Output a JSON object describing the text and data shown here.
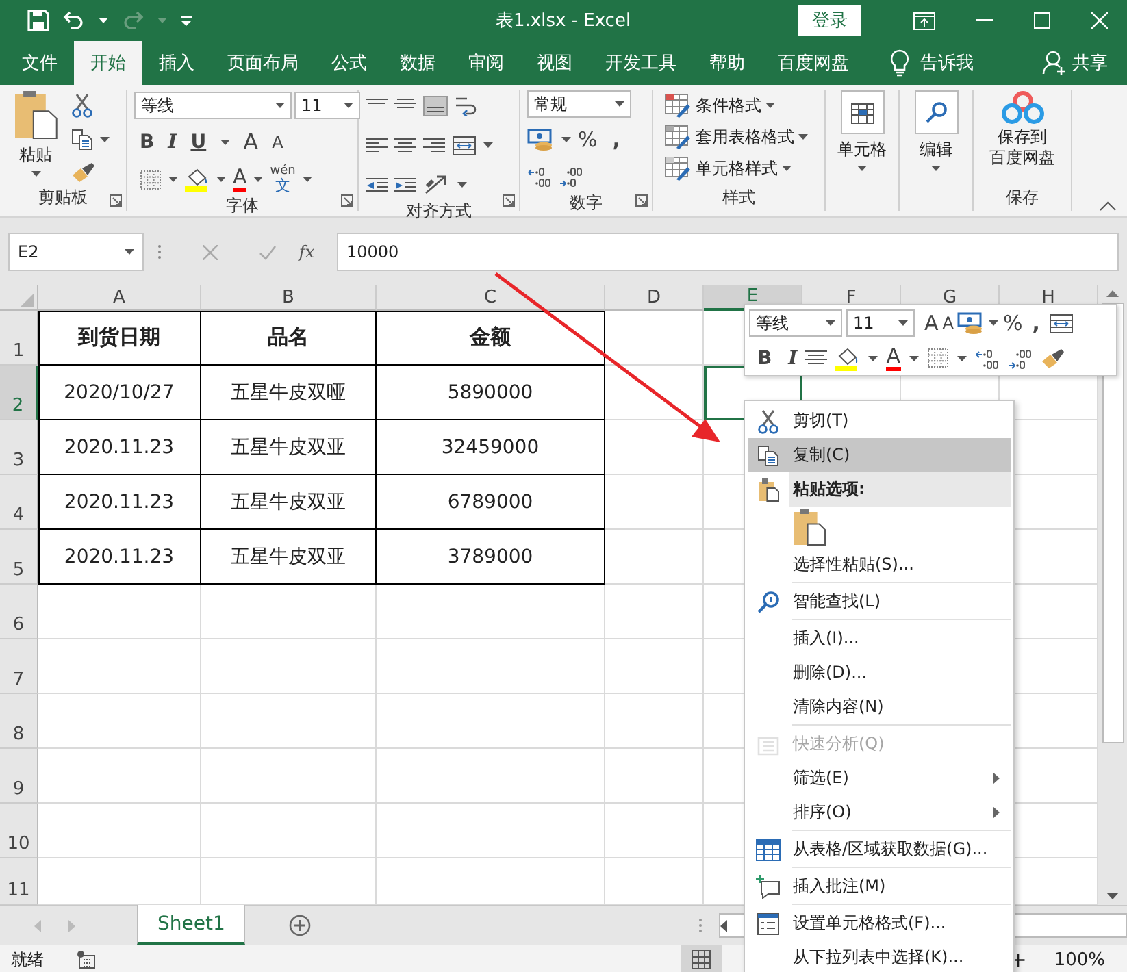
{
  "title_bar": {
    "title": "表1.xlsx  -  Excel",
    "login": "登录"
  },
  "menu_tabs": [
    {
      "label": "文件",
      "selected": false
    },
    {
      "label": "开始",
      "selected": true
    },
    {
      "label": "插入",
      "selected": false
    },
    {
      "label": "页面布局",
      "selected": false
    },
    {
      "label": "公式",
      "selected": false
    },
    {
      "label": "数据",
      "selected": false
    },
    {
      "label": "审阅",
      "selected": false
    },
    {
      "label": "视图",
      "selected": false
    },
    {
      "label": "开发工具",
      "selected": false
    },
    {
      "label": "帮助",
      "selected": false
    },
    {
      "label": "百度网盘",
      "selected": false
    }
  ],
  "tell_me": "告诉我",
  "share": "共享",
  "ribbon": {
    "clipboard": {
      "paste": "粘贴",
      "label": "剪贴板"
    },
    "font": {
      "name": "等线",
      "size": "11",
      "bold": "B",
      "italic": "I",
      "underline": "U",
      "grow": "A",
      "shrink": "A",
      "font_color": "A",
      "phonetic_top": "wén",
      "phonetic_bottom": "文",
      "label": "字体"
    },
    "alignment": {
      "label": "对齐方式"
    },
    "number": {
      "format": "常规",
      "percent": "%",
      "comma": ",",
      "label": "数字"
    },
    "styles": {
      "items": [
        "条件格式",
        "套用表格格式",
        "单元格样式"
      ],
      "label": "样式"
    },
    "cells": {
      "button": "单元格"
    },
    "editing": {
      "button": "编辑"
    },
    "save": {
      "button_line1": "保存到",
      "button_line2": "百度网盘",
      "label": "保存"
    }
  },
  "formula_bar": {
    "name_box": "E2",
    "fx": "fx",
    "value": "10000"
  },
  "sheet": {
    "columns": [
      {
        "label": "A",
        "selected": false
      },
      {
        "label": "B",
        "selected": false
      },
      {
        "label": "C",
        "selected": false
      },
      {
        "label": "D",
        "selected": false
      },
      {
        "label": "E",
        "selected": true
      },
      {
        "label": "F",
        "selected": false
      },
      {
        "label": "G",
        "selected": false
      },
      {
        "label": "H",
        "selected": false
      }
    ],
    "rows": [
      {
        "label": "1",
        "selected": false,
        "kind": "header",
        "cells": [
          "到货日期",
          "品名",
          "金额"
        ]
      },
      {
        "label": "2",
        "selected": true,
        "kind": "data",
        "cells": [
          "2020/10/27",
          "五星牛皮双哑",
          "5890000"
        ]
      },
      {
        "label": "3",
        "selected": false,
        "kind": "data",
        "cells": [
          "2020.11.23",
          "五星牛皮双亚",
          "32459000"
        ]
      },
      {
        "label": "4",
        "selected": false,
        "kind": "data",
        "cells": [
          "2020.11.23",
          "五星牛皮双亚",
          "6789000"
        ]
      },
      {
        "label": "5",
        "selected": false,
        "kind": "data",
        "cells": [
          "2020.11.23",
          "五星牛皮双亚",
          "3789000"
        ]
      },
      {
        "label": "6",
        "selected": false,
        "kind": "empty"
      },
      {
        "label": "7",
        "selected": false,
        "kind": "empty"
      },
      {
        "label": "8",
        "selected": false,
        "kind": "empty"
      },
      {
        "label": "9",
        "selected": false,
        "kind": "empty"
      },
      {
        "label": "10",
        "selected": false,
        "kind": "empty"
      },
      {
        "label": "11",
        "selected": false,
        "kind": "empty"
      }
    ]
  },
  "sheet_tabs": [
    {
      "label": "Sheet1",
      "selected": true
    }
  ],
  "status_bar": {
    "status": "就绪",
    "zoom_in": "+",
    "zoom": "100%"
  },
  "mini_toolbar": {
    "font": "等线",
    "size": "11",
    "grow": "A",
    "shrink": "A",
    "percent": "%",
    "comma": ",",
    "bold": "B",
    "italic": "I",
    "font_color": "A"
  },
  "context_menu": [
    {
      "kind": "cut",
      "label": "剪切(T)",
      "selected": false,
      "disabled": false,
      "submenu": false,
      "separator_before": false
    },
    {
      "kind": "copy",
      "label": "复制(C)",
      "selected": true,
      "disabled": false,
      "submenu": false,
      "separator_before": false
    },
    {
      "kind": "paste_header",
      "label": "粘贴选项:",
      "selected": false,
      "disabled": false,
      "submenu": false,
      "separator_before": false
    },
    {
      "kind": "paste_options",
      "selected": false,
      "disabled": false,
      "submenu": false,
      "separator_before": false
    },
    {
      "kind": "plain",
      "label": "选择性粘贴(S)...",
      "selected": false,
      "disabled": false,
      "submenu": false,
      "separator_before": false
    },
    {
      "kind": "lookup",
      "label": "智能查找(L)",
      "selected": false,
      "disabled": false,
      "submenu": false,
      "separator_before": true
    },
    {
      "kind": "plain",
      "label": "插入(I)...",
      "selected": false,
      "disabled": false,
      "submenu": false,
      "separator_before": true
    },
    {
      "kind": "plain",
      "label": "删除(D)...",
      "selected": false,
      "disabled": false,
      "submenu": false,
      "separator_before": false
    },
    {
      "kind": "plain",
      "label": "清除内容(N)",
      "selected": false,
      "disabled": false,
      "submenu": false,
      "separator_before": false
    },
    {
      "kind": "quick_analysis",
      "label": "快速分析(Q)",
      "selected": false,
      "disabled": true,
      "submenu": false,
      "separator_before": true
    },
    {
      "kind": "plain",
      "label": "筛选(E)",
      "selected": false,
      "disabled": false,
      "submenu": true,
      "separator_before": false
    },
    {
      "kind": "plain",
      "label": "排序(O)",
      "selected": false,
      "disabled": false,
      "submenu": true,
      "separator_before": false
    },
    {
      "kind": "table",
      "label": "从表格/区域获取数据(G)...",
      "selected": false,
      "disabled": false,
      "submenu": false,
      "separator_before": true
    },
    {
      "kind": "comment",
      "label": "插入批注(M)",
      "selected": false,
      "disabled": false,
      "submenu": false,
      "separator_before": true
    },
    {
      "kind": "format",
      "label": "设置单元格格式(F)...",
      "selected": false,
      "disabled": false,
      "submenu": false,
      "separator_before": true
    },
    {
      "kind": "plain",
      "label": "从下拉列表中选择(K)...",
      "selected": false,
      "disabled": false,
      "submenu": false,
      "separator_before": false
    }
  ]
}
